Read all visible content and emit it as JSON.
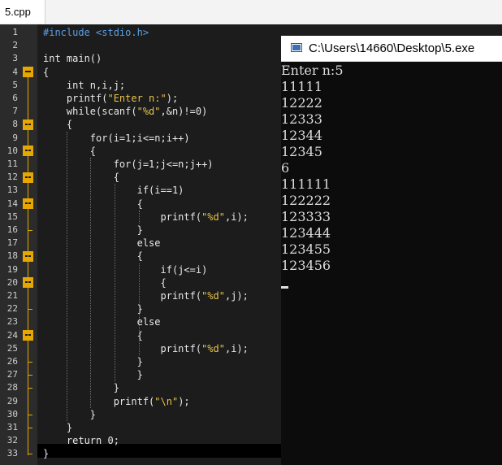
{
  "tab": {
    "label": "5.cpp"
  },
  "console": {
    "title": "C:\\Users\\14660\\Desktop\\5.exe",
    "lines": [
      "Enter n:5",
      "11111",
      "12222",
      "12333",
      "12344",
      "12345",
      "6",
      "111111",
      "122222",
      "123333",
      "123444",
      "123455",
      "123456"
    ]
  },
  "editor": {
    "line_numbers": [
      "1",
      "2",
      "3",
      "4",
      "5",
      "6",
      "7",
      "8",
      "9",
      "10",
      "11",
      "12",
      "13",
      "14",
      "15",
      "16",
      "17",
      "18",
      "19",
      "20",
      "21",
      "22",
      "23",
      "24",
      "25",
      "26",
      "27",
      "28",
      "29",
      "30",
      "31",
      "32",
      "33"
    ],
    "code": [
      "#include <stdio.h>",
      "",
      "int main()",
      "{",
      "    int n,i,j;",
      "    printf(\"Enter n:\");",
      "    while(scanf(\"%d\",&n)!=0)",
      "    {",
      "        for(i=1;i<=n;i++)",
      "        {",
      "            for(j=1;j<=n;j++)",
      "            {",
      "                if(i==1)",
      "                {",
      "                    printf(\"%d\",i);",
      "                }",
      "                else",
      "                {",
      "                    if(j<=i)",
      "                    {",
      "                    printf(\"%d\",j);",
      "                }",
      "                else",
      "                {",
      "                    printf(\"%d\",i);",
      "                }",
      "                }",
      "            }",
      "            printf(\"\\n\");",
      "        }",
      "    }",
      "    return 0;",
      "}"
    ]
  },
  "colors": {
    "fold": "#e6a800",
    "string": "#e6c34a",
    "preprocessor": "#5aa0e6"
  }
}
